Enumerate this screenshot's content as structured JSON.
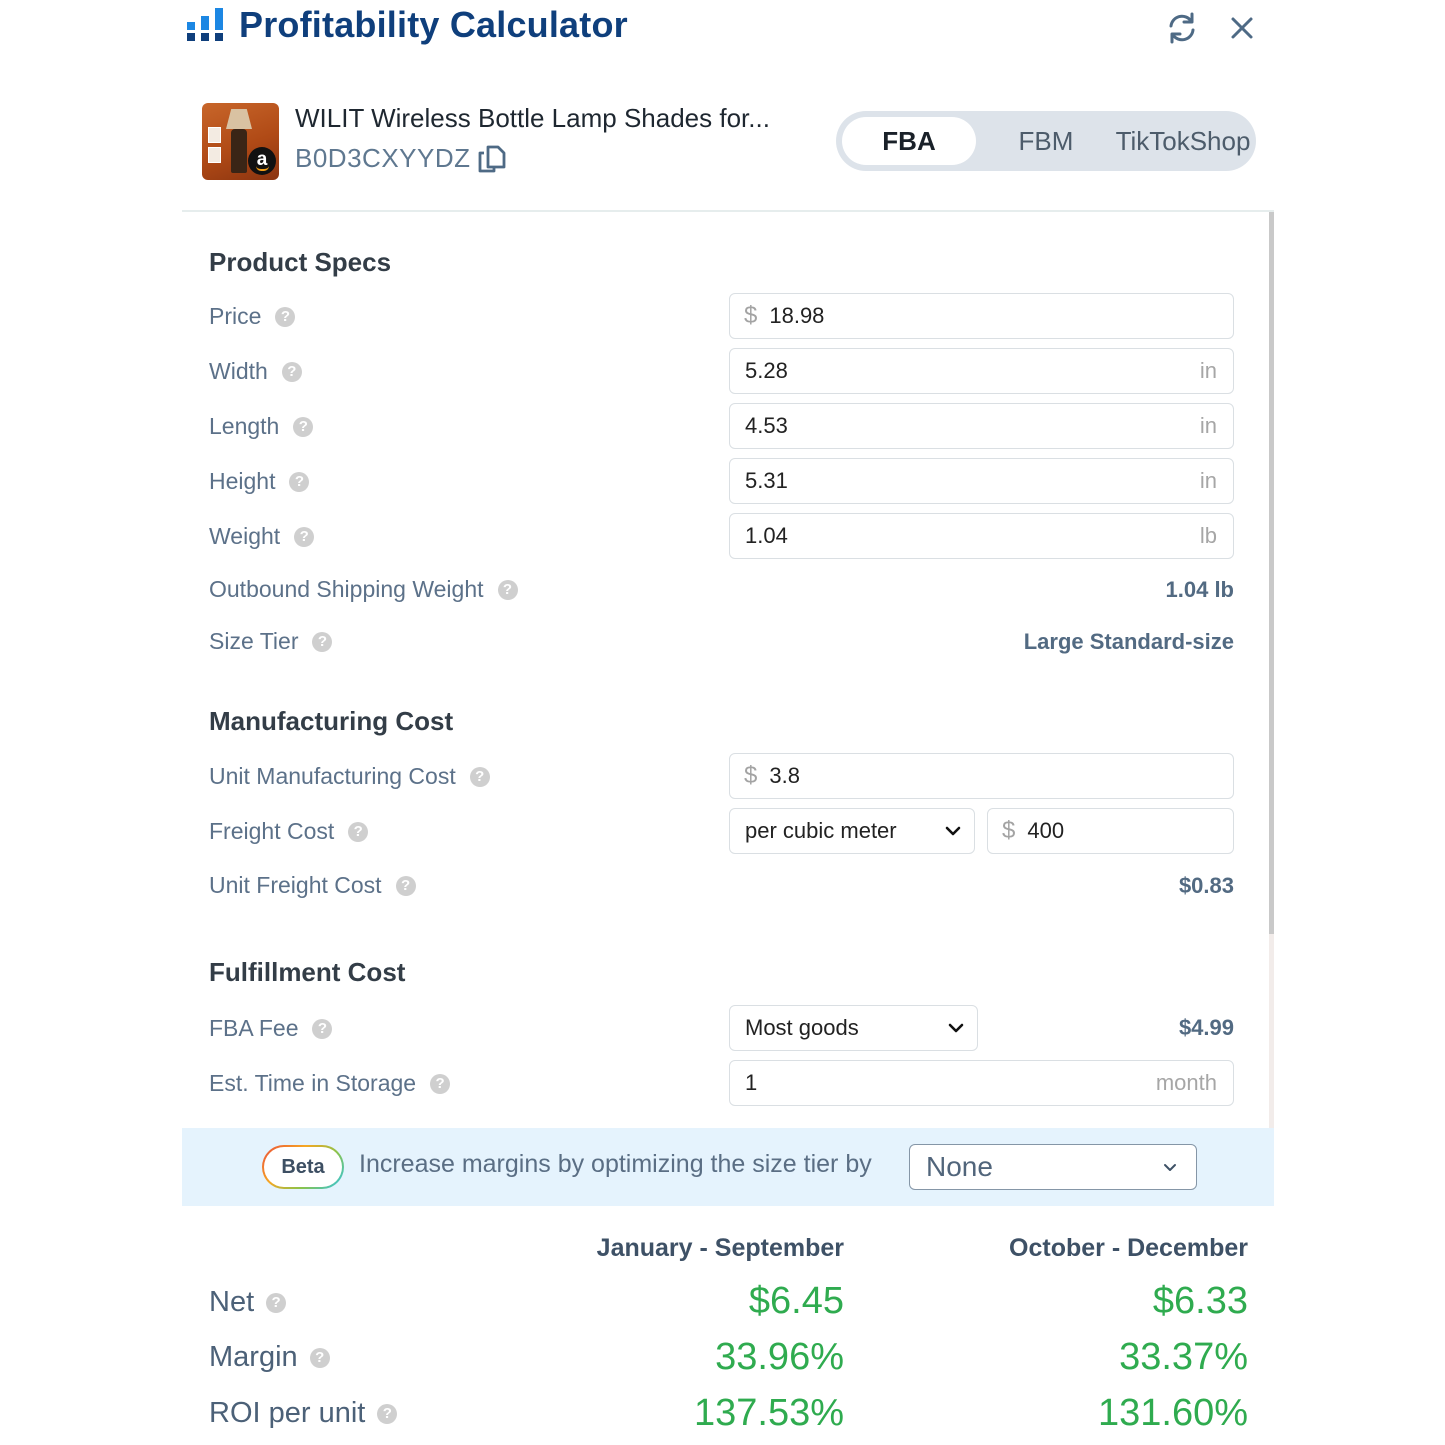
{
  "header": {
    "title": "Profitability Calculator",
    "refresh_icon": "refresh-icon",
    "close_icon": "close-icon",
    "logo_icon": "bar-chart-icon"
  },
  "product": {
    "title": "WILIT Wireless Bottle Lamp Shades for...",
    "asin": "B0D3CXYYDZ",
    "marketplace_badge": "a"
  },
  "channels": {
    "tabs": [
      {
        "label": "FBA",
        "active": true
      },
      {
        "label": "FBM",
        "active": false
      },
      {
        "label": "TikTokShop",
        "active": false
      }
    ]
  },
  "product_specs": {
    "title": "Product Specs",
    "price": {
      "label": "Price",
      "prefix": "$",
      "value": "18.98"
    },
    "width": {
      "label": "Width",
      "value": "5.28",
      "unit": "in"
    },
    "length": {
      "label": "Length",
      "value": "4.53",
      "unit": "in"
    },
    "height": {
      "label": "Height",
      "value": "5.31",
      "unit": "in"
    },
    "weight": {
      "label": "Weight",
      "value": "1.04",
      "unit": "lb"
    },
    "outbound_weight": {
      "label": "Outbound Shipping Weight",
      "value": "1.04 lb"
    },
    "size_tier": {
      "label": "Size Tier",
      "value": "Large Standard-size"
    }
  },
  "manufacturing_cost": {
    "title": "Manufacturing Cost",
    "unit_cost": {
      "label": "Unit Manufacturing Cost",
      "prefix": "$",
      "value": "3.8"
    },
    "freight_cost": {
      "label": "Freight Cost",
      "basis": "per cubic meter",
      "prefix": "$",
      "value": "400"
    },
    "unit_freight_cost": {
      "label": "Unit Freight Cost",
      "value": "$0.83"
    }
  },
  "fulfillment_cost": {
    "title": "Fulfillment Cost",
    "fba_fee": {
      "label": "FBA Fee",
      "category": "Most goods",
      "value": "$4.99"
    },
    "storage_time": {
      "label": "Est. Time in Storage",
      "value": "1",
      "unit": "month"
    }
  },
  "optimizer": {
    "badge": "Beta",
    "text": "Increase margins by optimizing the size tier by",
    "selected": "None"
  },
  "results": {
    "columns": [
      "January - September",
      "October - December"
    ],
    "rows": [
      {
        "label": "Net",
        "values": [
          "$6.45",
          "$6.33"
        ]
      },
      {
        "label": "Margin",
        "values": [
          "33.96%",
          "33.37%"
        ]
      },
      {
        "label": "ROI per unit",
        "values": [
          "137.53%",
          "131.60%"
        ]
      }
    ],
    "positive_color": "#2fab4f"
  },
  "help_glyph": "?"
}
